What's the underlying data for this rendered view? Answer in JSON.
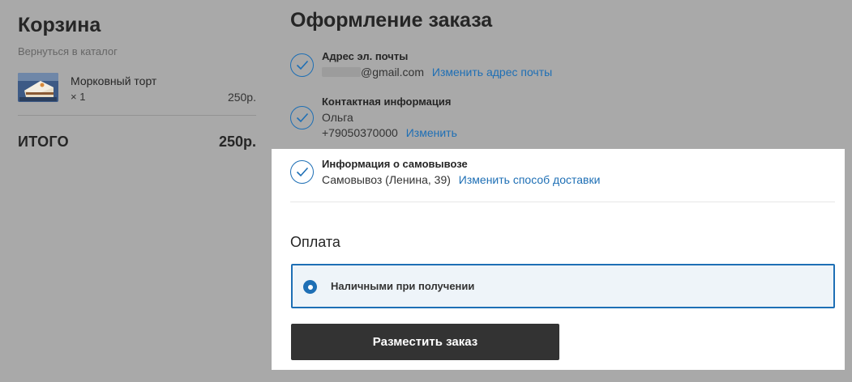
{
  "cart": {
    "title": "Корзина",
    "back_link": "Вернуться в каталог",
    "item": {
      "name": "Морковный торт",
      "qty": "× 1",
      "price": "250р."
    },
    "total_label": "ИТОГО",
    "total_value": "250р."
  },
  "checkout": {
    "title": "Оформление заказа",
    "email": {
      "title": "Адрес эл. почты",
      "value": "@gmail.com",
      "change": "Изменить адрес почты"
    },
    "contact": {
      "title": "Контактная информация",
      "name": "Ольга",
      "phone": "+79050370000",
      "change": "Изменить"
    },
    "pickup": {
      "title": "Информация о самовывозе",
      "value": "Самовывоз (Ленина, 39)",
      "change": "Изменить способ доставки"
    },
    "payment": {
      "title": "Оплата",
      "option": "Наличными при получении"
    },
    "submit": "Разместить заказ"
  },
  "colors": {
    "accent": "#1e6fb5",
    "overlay_background": "#a9a9a9",
    "button": "#333333",
    "selected_option_bg": "#eef4f9"
  },
  "icons": {
    "step_done": "check-circle-icon",
    "radio_selected": "radio-selected-icon"
  }
}
